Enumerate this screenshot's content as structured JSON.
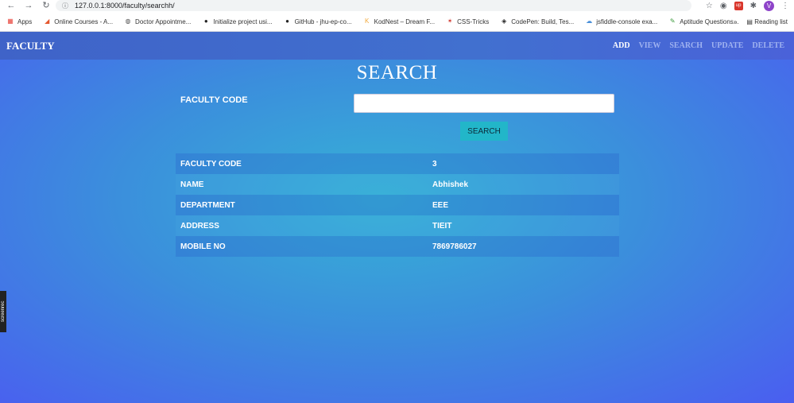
{
  "browser": {
    "url": "127.0.0.1:8000/faculty/searchh/",
    "profile_initial": "V",
    "bookmarks": [
      {
        "label": "Apps",
        "icon": "apps-grid-icon",
        "color": "#e8453c"
      },
      {
        "label": "Online Courses - A...",
        "icon": "courses-icon",
        "color": "#e4572e"
      },
      {
        "label": "Doctor Appointme...",
        "icon": "globe-icon",
        "color": "#555555"
      },
      {
        "label": "Initialize project usi...",
        "icon": "github-icon",
        "color": "#222222"
      },
      {
        "label": "GitHub - jhu-ep-co...",
        "icon": "github-icon",
        "color": "#222222"
      },
      {
        "label": "KodNest – Dream F...",
        "icon": "kodnest-icon",
        "color": "#f2a93b"
      },
      {
        "label": "CSS-Tricks",
        "icon": "css-tricks-icon",
        "color": "#d0342c"
      },
      {
        "label": "CodePen: Build, Tes...",
        "icon": "codepen-icon",
        "color": "#222222"
      },
      {
        "label": "jsfiddle-console exa...",
        "icon": "jsfiddle-icon",
        "color": "#4a90d9"
      },
      {
        "label": "Aptitude Questions...",
        "icon": "aptitude-icon",
        "color": "#3a9a3a"
      }
    ],
    "more_label": "»",
    "reading_list_label": "Reading list"
  },
  "navbar": {
    "brand": "FACULTY",
    "links": [
      "ADD",
      "VIEW",
      "SEARCH",
      "UPDATE",
      "DELETE"
    ]
  },
  "search": {
    "heading": "SEARCH",
    "field_label": "FACULTY CODE",
    "input_value": "",
    "button_label": "SEARCH"
  },
  "result": {
    "rows": [
      {
        "key": "FACULTY CODE",
        "value": "3"
      },
      {
        "key": "NAME",
        "value": "Abhishek"
      },
      {
        "key": "DEPARTMENT",
        "value": "EEE"
      },
      {
        "key": "ADDRESS",
        "value": "TIEIT"
      },
      {
        "key": "MOBILE NO",
        "value": "7869786027"
      }
    ]
  },
  "recorder_tab": "screenrec",
  "colors": {
    "navbar": "#4170cf",
    "button": "#22b6c9",
    "link_inactive": "#9fb2f0"
  }
}
